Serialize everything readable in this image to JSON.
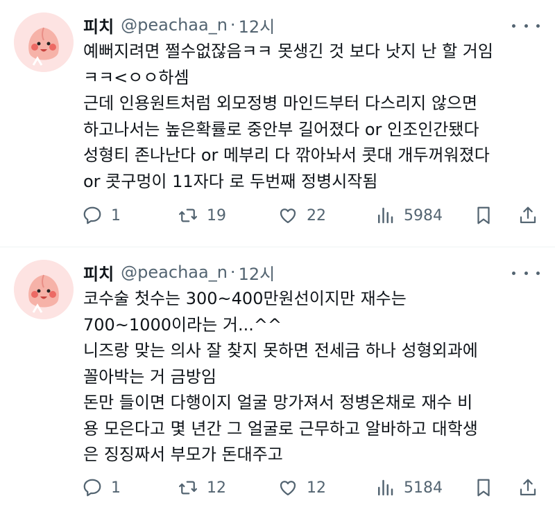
{
  "tweets": [
    {
      "display_name": "피치",
      "handle": "@peachaa_n",
      "separator": "·",
      "time": "12시",
      "lines": [
        "예뻐지려면 쩔수없잖음ㅋㅋ 못생긴 것 보다 낫지 난 할 거임",
        "ㅋㅋ<ㅇㅇ하셈",
        "근데 인용원트처럼 외모정병 마인드부터 다스리지 않으면",
        "하고나서는 높은확률로 중안부 길어졌다 or 인조인간됐다",
        "성형티 존나난다 or 메부리 다 깎아놔서 콧대 개두꺼워졌다",
        "or 콧구멍이 11자다 로 두번째 정병시작됨"
      ],
      "stats": {
        "replies": "1",
        "retweets": "19",
        "likes": "22",
        "views": "5984"
      }
    },
    {
      "display_name": "피치",
      "handle": "@peachaa_n",
      "separator": "·",
      "time": "12시",
      "lines": [
        "코수술 첫수는 300~400만원선이지만 재수는",
        "700~1000이라는 거...^^",
        "니즈랑 맞는 의사 잘 찾지 못하면 전세금 하나 성형외과에",
        "꼴아박는 거 금방임",
        "돈만 들이면 다행이지 얼굴 망가져서 정병온채로 재수 비",
        "용 모은다고 몇 년간 그 얼굴로 근무하고 알바하고 대학생",
        "은 징징짜서 부모가 돈대주고"
      ],
      "stats": {
        "replies": "1",
        "retweets": "12",
        "likes": "12",
        "views": "5184"
      }
    }
  ],
  "icons": {
    "reply": "reply-icon",
    "retweet": "retweet-icon",
    "like": "heart-icon",
    "views": "views-icon",
    "bookmark": "bookmark-icon",
    "share": "share-icon",
    "more": "more-icon"
  },
  "colors": {
    "text": "#0f1419",
    "muted": "#536471",
    "avatar_bg": "#fde3e2"
  }
}
